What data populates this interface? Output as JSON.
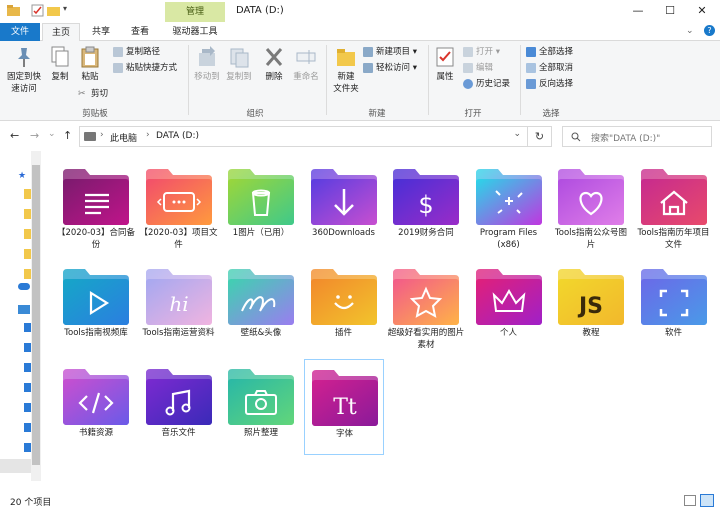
{
  "window": {
    "context_tab": "管理",
    "title": "DATA (D:)",
    "min": "—",
    "max": "☐",
    "close": "✕"
  },
  "tabs": {
    "file": "文件",
    "home": "主页",
    "share": "共享",
    "view": "查看",
    "drive_tools": "驱动器工具"
  },
  "ribbon": {
    "pin": "固定到快\n速访问",
    "copy": "复制",
    "paste": "粘贴",
    "copy_path": "复制路径",
    "paste_shortcut": "粘贴快捷方式",
    "cut": "剪切",
    "group_clipboard": "剪贴板",
    "move_to": "移动到",
    "copy_to": "复制到",
    "delete": "删除",
    "rename": "重命名",
    "group_organize": "组织",
    "new_folder": "新建\n文件夹",
    "new_item": "新建项目",
    "easy_access": "轻松访问",
    "group_new": "新建",
    "properties": "属性",
    "open": "打开",
    "edit": "编辑",
    "history": "历史记录",
    "group_open": "打开",
    "select_all": "全部选择",
    "select_none": "全部取消",
    "invert": "反向选择",
    "group_select": "选择"
  },
  "address": {
    "back": "←",
    "forward": "→",
    "recent": "⌄",
    "up": "↑",
    "crumb1": "此电脑",
    "sep": "›",
    "crumb2": "DATA (D:)",
    "dropdown": "⌄",
    "refresh": "↻",
    "search_placeholder": "搜索\"DATA (D:)\""
  },
  "items": [
    {
      "label": "【2020-03】合同备份",
      "c1": "#7b1b6e",
      "c2": "#c0148a",
      "icon": "document-lines-icon"
    },
    {
      "label": "【2020-03】项目文件",
      "c1": "#f24e6b",
      "c2": "#ff9a3d",
      "icon": "ellipsis-box-icon"
    },
    {
      "label": "1图片（已用）",
      "c1": "#9bd63b",
      "c2": "#3fc98a",
      "icon": "trash-icon"
    },
    {
      "label": "360Downloads",
      "c1": "#5a3de0",
      "c2": "#c84fd0",
      "icon": "download-arrow-icon"
    },
    {
      "label": "2019财务合同",
      "c1": "#4a2fd6",
      "c2": "#9a2cc8",
      "icon": "dollar-icon"
    },
    {
      "label": "Program Files (x86)",
      "c1": "#2ad6e8",
      "c2": "#c036e0",
      "icon": "sparkle-icon"
    },
    {
      "label": "Tools指南公众号图片",
      "c1": "#b04de0",
      "c2": "#e07ee8",
      "icon": "heart-icon"
    },
    {
      "label": "Tools指南历年项目文件",
      "c1": "#c72b8e",
      "c2": "#e84a6b",
      "icon": "house-icon"
    },
    {
      "label": "Tools指南视频库",
      "c1": "#16a6c8",
      "c2": "#2b7ee0",
      "icon": "play-icon"
    },
    {
      "label": "Tools指南运营资料",
      "c1": "#a6a8f0",
      "c2": "#f0b4e0",
      "icon": "handwriting-icon"
    },
    {
      "label": "壁纸&头像",
      "c1": "#3fd1b0",
      "c2": "#9a7df0",
      "icon": "scribble-icon"
    },
    {
      "label": "插件",
      "c1": "#f28a2c",
      "c2": "#f2c42c",
      "icon": "smile-icon"
    },
    {
      "label": "超级好看实用的图片素材",
      "c1": "#f25a8a",
      "c2": "#ffb347",
      "icon": "star-icon"
    },
    {
      "label": "个人",
      "c1": "#e0207a",
      "c2": "#a020c8",
      "icon": "crown-icon"
    },
    {
      "label": "教程",
      "c1": "#f2d62c",
      "c2": "#f2b82c",
      "icon": "js-icon"
    },
    {
      "label": "软件",
      "c1": "#6a6ae8",
      "c2": "#4a9ae8",
      "icon": "frame-corners-icon"
    },
    {
      "label": "书籍资源",
      "c1": "#c84fd0",
      "c2": "#6a5ae8",
      "icon": "code-icon"
    },
    {
      "label": "音乐文件",
      "c1": "#7a2ad0",
      "c2": "#3a2ab8",
      "icon": "music-note-icon"
    },
    {
      "label": "照片整理",
      "c1": "#2ab8a6",
      "c2": "#62d67a",
      "icon": "camera-icon"
    },
    {
      "label": "字体",
      "c1": "#d02090",
      "c2": "#8a1a9a",
      "icon": "typeface-icon"
    }
  ],
  "status": {
    "count": "20 个项目"
  }
}
